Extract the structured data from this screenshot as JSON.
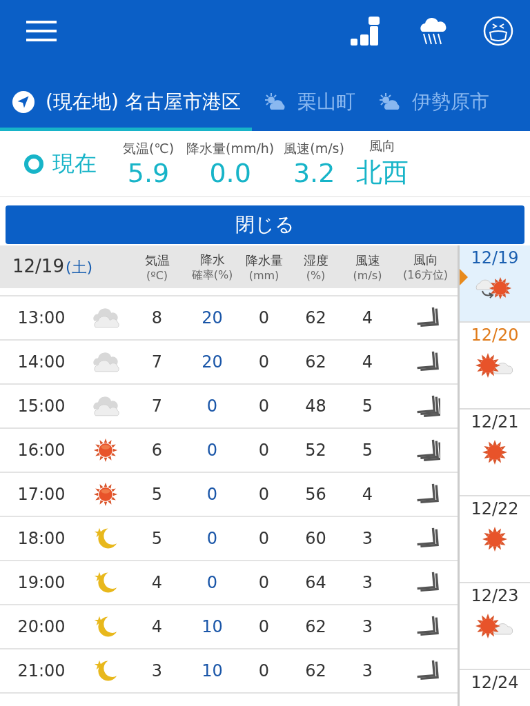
{
  "tabs": [
    {
      "label": "(現在地) 名古屋市港区",
      "kind": "location",
      "selected": true
    },
    {
      "label": "栗山町",
      "kind": "partly_cloudy",
      "selected": false
    },
    {
      "label": "伊勢原市",
      "kind": "partly_cloudy",
      "selected": false
    }
  ],
  "current": {
    "label": "現在",
    "stats": [
      {
        "label": "気温(℃)",
        "value": "5.9"
      },
      {
        "label": "降水量(mm/h)",
        "value": "0.0"
      },
      {
        "label": "風速(m/s)",
        "value": "3.2"
      },
      {
        "label": "風向",
        "value": "北西"
      }
    ]
  },
  "close_button": "閉じる",
  "table": {
    "date": "12/19",
    "weekday": "(土)",
    "columns": [
      {
        "label": "気温",
        "unit": "(ºC)"
      },
      {
        "label": "降水",
        "unit": "確率(%)"
      },
      {
        "label": "降水量",
        "unit": "(mm)"
      },
      {
        "label": "湿度",
        "unit": "(%)"
      },
      {
        "label": "風速",
        "unit": "(m/s)"
      },
      {
        "label": "風向",
        "unit": "(16方位)"
      }
    ],
    "rows": [
      {
        "time": "13:00",
        "kind": "cloudy",
        "temp": "8",
        "prob": "20",
        "amount": "0",
        "humidity": "62",
        "speed": "4",
        "wind": {
          "kind": "double"
        }
      },
      {
        "time": "14:00",
        "kind": "cloudy",
        "temp": "7",
        "prob": "20",
        "amount": "0",
        "humidity": "62",
        "speed": "4",
        "wind": {
          "kind": "double"
        }
      },
      {
        "time": "15:00",
        "kind": "cloudy",
        "temp": "7",
        "prob": "0",
        "amount": "0",
        "humidity": "48",
        "speed": "5",
        "wind": {
          "kind": "triple"
        }
      },
      {
        "time": "16:00",
        "kind": "sunny",
        "temp": "6",
        "prob": "0",
        "amount": "0",
        "humidity": "52",
        "speed": "5",
        "wind": {
          "kind": "triple"
        }
      },
      {
        "time": "17:00",
        "kind": "sunny",
        "temp": "5",
        "prob": "0",
        "amount": "0",
        "humidity": "56",
        "speed": "4",
        "wind": {
          "kind": "double"
        }
      },
      {
        "time": "18:00",
        "kind": "night",
        "temp": "5",
        "prob": "0",
        "amount": "0",
        "humidity": "60",
        "speed": "3",
        "wind": {
          "kind": "double"
        }
      },
      {
        "time": "19:00",
        "kind": "night",
        "temp": "4",
        "prob": "0",
        "amount": "0",
        "humidity": "64",
        "speed": "3",
        "wind": {
          "kind": "double"
        }
      },
      {
        "time": "20:00",
        "kind": "night",
        "temp": "4",
        "prob": "10",
        "amount": "0",
        "humidity": "62",
        "speed": "3",
        "wind": {
          "kind": "double"
        }
      },
      {
        "time": "21:00",
        "kind": "night",
        "temp": "3",
        "prob": "10",
        "amount": "0",
        "humidity": "62",
        "speed": "3",
        "wind": {
          "kind": "double"
        }
      }
    ]
  },
  "days": [
    {
      "date": "12/19",
      "kind": "cloudy_to_sunny",
      "color": "#1a5fb0",
      "selected": true
    },
    {
      "date": "12/20",
      "kind": "sunny_cloudy",
      "color": "#e07b1a",
      "selected": false
    },
    {
      "date": "12/21",
      "kind": "sunny",
      "color": "#333333",
      "selected": false
    },
    {
      "date": "12/22",
      "kind": "sunny",
      "color": "#333333",
      "selected": false
    },
    {
      "date": "12/23",
      "kind": "sunny_cloudy",
      "color": "#333333",
      "selected": false
    },
    {
      "date": "12/24",
      "color": "#333333",
      "selected": false
    }
  ]
}
